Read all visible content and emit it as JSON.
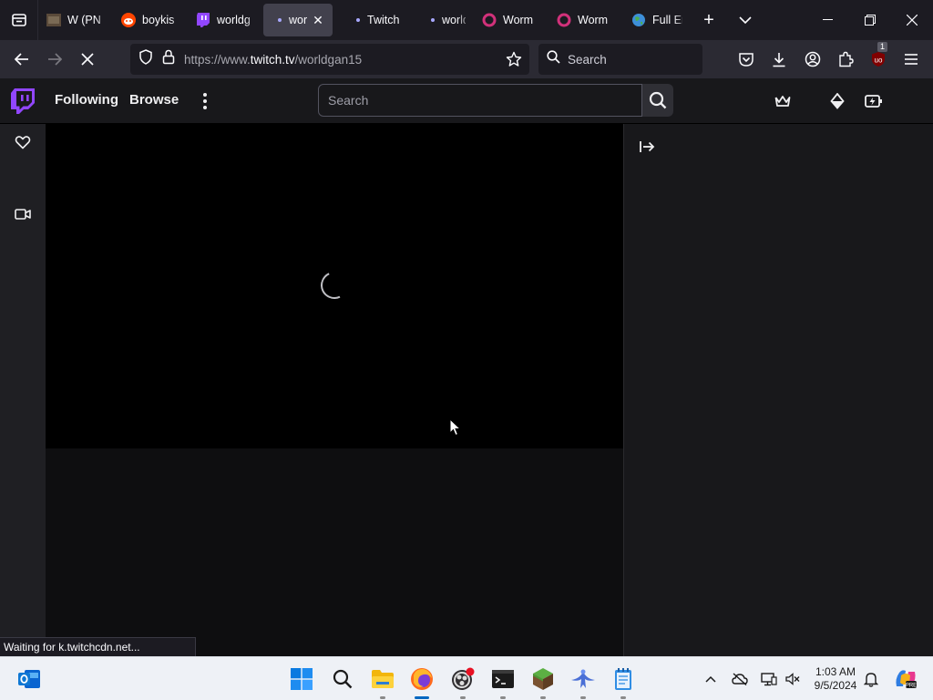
{
  "browser": {
    "tabs": [
      {
        "label": "W (PN",
        "icon": "image-thumbnail-icon",
        "active": false
      },
      {
        "label": "boykis",
        "icon": "reddit-icon",
        "active": false
      },
      {
        "label": "worldg",
        "icon": "twitch-icon",
        "active": false
      },
      {
        "label": "wor",
        "icon": "dot-icon",
        "active": true
      },
      {
        "label": "Twitch",
        "icon": "dot-icon",
        "active": false
      },
      {
        "label": "worldg",
        "icon": "dot-icon",
        "active": false
      },
      {
        "label": "Worm",
        "icon": "ring-icon",
        "active": false
      },
      {
        "label": "Worm",
        "icon": "ring-icon",
        "active": false
      },
      {
        "label": "Full En",
        "icon": "globe-icon",
        "active": false
      }
    ],
    "new_tab": "+",
    "url_prefix": "https://www.",
    "url_host": "twitch.tv",
    "url_path": "/worldgan15",
    "search_placeholder": "Search",
    "extension_badge": "1",
    "status_text": "Waiting for k.twitchcdn.net..."
  },
  "twitch": {
    "nav_following": "Following",
    "nav_browse": "Browse",
    "search_placeholder": "Search",
    "brand_color": "#9146ff"
  },
  "taskbar": {
    "time": "1:03 AM",
    "date": "9/5/2024"
  }
}
